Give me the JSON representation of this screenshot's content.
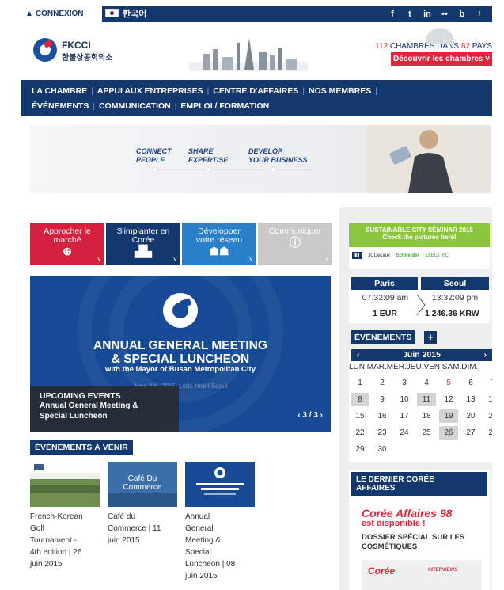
{
  "topbar": {
    "login_label": "CONNEXION",
    "language_label": "한국어",
    "social": [
      "f",
      "t",
      "in",
      "••",
      "b",
      "rss"
    ]
  },
  "header": {
    "org_name": "FKCCI",
    "org_sub": "한불상공회의소",
    "chambers_count": "112",
    "chambers_text": "CHAMBRES DANS",
    "countries_count": "82",
    "countries_text": "PAYS",
    "discover_label": "Découvrir les chambres ˅"
  },
  "nav": {
    "row1": [
      "LA CHAMBRE",
      "APPUI AUX ENTREPRISES",
      "CENTRE D'AFFAIRES",
      "NOS MEMBRES"
    ],
    "row2": [
      "ÉVÉNEMENTS",
      "COMMUNICATION",
      "EMPLOI / FORMATION"
    ]
  },
  "banner": {
    "t1": "CONNECT",
    "t1b": "PEOPLE",
    "t2": "SHARE",
    "t2b": "EXPERTISE",
    "t3": "DEVELOP",
    "t3b": "YOUR BUSINESS"
  },
  "tiles": [
    {
      "line1": "Approcher le",
      "line2": "marché",
      "icon": "⊕",
      "color": "#d4213f"
    },
    {
      "line1": "S'implanter en",
      "line2": "Corée",
      "icon": "▮▮",
      "color": "#12386d"
    },
    {
      "line1": "Développer",
      "line2": "votre réseau",
      "icon": "👥",
      "color": "#2a7fc9"
    },
    {
      "line1": "Communiquer",
      "line2": "",
      "icon": "ⓘ",
      "color": "#c9c9c9"
    }
  ],
  "hero": {
    "title1": "ANNUAL GENERAL MEETING",
    "title2": "& SPECIAL LUNCHEON",
    "subtitle": "with the Mayor of Busan Metropolitan City",
    "date_line": "June 8th, 2015, Lotte Hotel Seoul",
    "overlay_title": "UPCOMING EVENTS",
    "overlay_line1": "Annual General Meeting &",
    "overlay_line2": "Special Luncheon",
    "pager": "‹ 3 / 3 ›"
  },
  "upcoming": {
    "label": "ÉVÉNEMENTS À VENIR",
    "items": [
      {
        "thumb_title": "French-Korean Golf Tournament",
        "l1": "French-Korean",
        "l2": "Golf",
        "l3": "Tournament -",
        "l4": "4th edition | 26",
        "l5": "juin 2015"
      },
      {
        "thumb_title": "Café Du Commerce",
        "l1": "Café du",
        "l2": "Commerce | 11",
        "l3": "juin 2015",
        "l4": "",
        "l5": ""
      },
      {
        "thumb_title": "ANNUAL GENERAL MEETING & SPECIAL LUNCHEON",
        "l1": "Annual",
        "l2": "General",
        "l3": "Meeting &",
        "l4": "Special",
        "l5": "Luncheon | 08",
        "l6": "juin 2015"
      }
    ]
  },
  "sustainable": {
    "line1": "SUSTAINABLE CITY SEMINAR 2015",
    "line2": "Check the pictures here!",
    "logos": [
      "JCDecaux",
      "Schneider",
      "ELECTRIC"
    ]
  },
  "clock": {
    "city1": "Paris",
    "city2": "Seoul",
    "time1": "07:32:09 am",
    "time2": "13:32:09 pm",
    "rate_left": "1 EUR",
    "rate_right": "1 246.36 KRW"
  },
  "calendar": {
    "label": "ÉVÉNEMENTS",
    "plus": "+",
    "month": "Juin 2015",
    "dow": "LUN.MAR.MER.JEU.VEN.SAM.DIM.",
    "weeks": [
      [
        "1",
        "2",
        "3",
        "4",
        "5",
        "6",
        "7"
      ],
      [
        "8",
        "9",
        "10",
        "11",
        "12",
        "13",
        "14"
      ],
      [
        "15",
        "16",
        "17",
        "18",
        "19",
        "20",
        "21"
      ],
      [
        "22",
        "23",
        "24",
        "25",
        "26",
        "27",
        "28"
      ],
      [
        "29",
        "30",
        "",
        "",
        "",
        "",
        ""
      ]
    ]
  },
  "dernier": {
    "label1": "LE DERNIER CORÉE",
    "label2": "AFFAIRES",
    "title": "Corée Affaires 98",
    "subtitle": "est disponible !",
    "text1": "DOSSIER SPÉCIAL SUR LES",
    "text2": "COSMÉTIQUES",
    "mag_name": "Corée",
    "mag_interviews": "INTERVIEWS"
  },
  "colors": {
    "navy": "#12386d",
    "red": "#e1253c",
    "blue": "#2a7fc9",
    "green": "#8cc63f"
  }
}
